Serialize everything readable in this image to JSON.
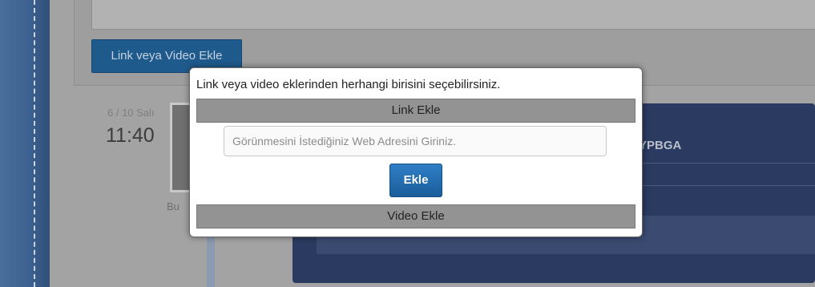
{
  "background": {
    "link_button_label": "Link veya Video Ekle",
    "post_date": "6 / 10 Salı",
    "post_time": "11:40",
    "author_name_fragment": "Bu",
    "card_title_fragment": "YPBGA"
  },
  "modal": {
    "message": "Link veya video eklerinden herhangi birisini seçebilirsiniz.",
    "link_section_label": "Link Ekle",
    "url_placeholder": "Görünmesini İstediğiniz Web Adresini Giriniz.",
    "url_value": "",
    "add_button_label": "Ekle",
    "video_section_label": "Video Ekle"
  },
  "colors": {
    "primary_button": "#1a5d9a",
    "section_bar": "#939393",
    "rail": "#3d6190"
  }
}
